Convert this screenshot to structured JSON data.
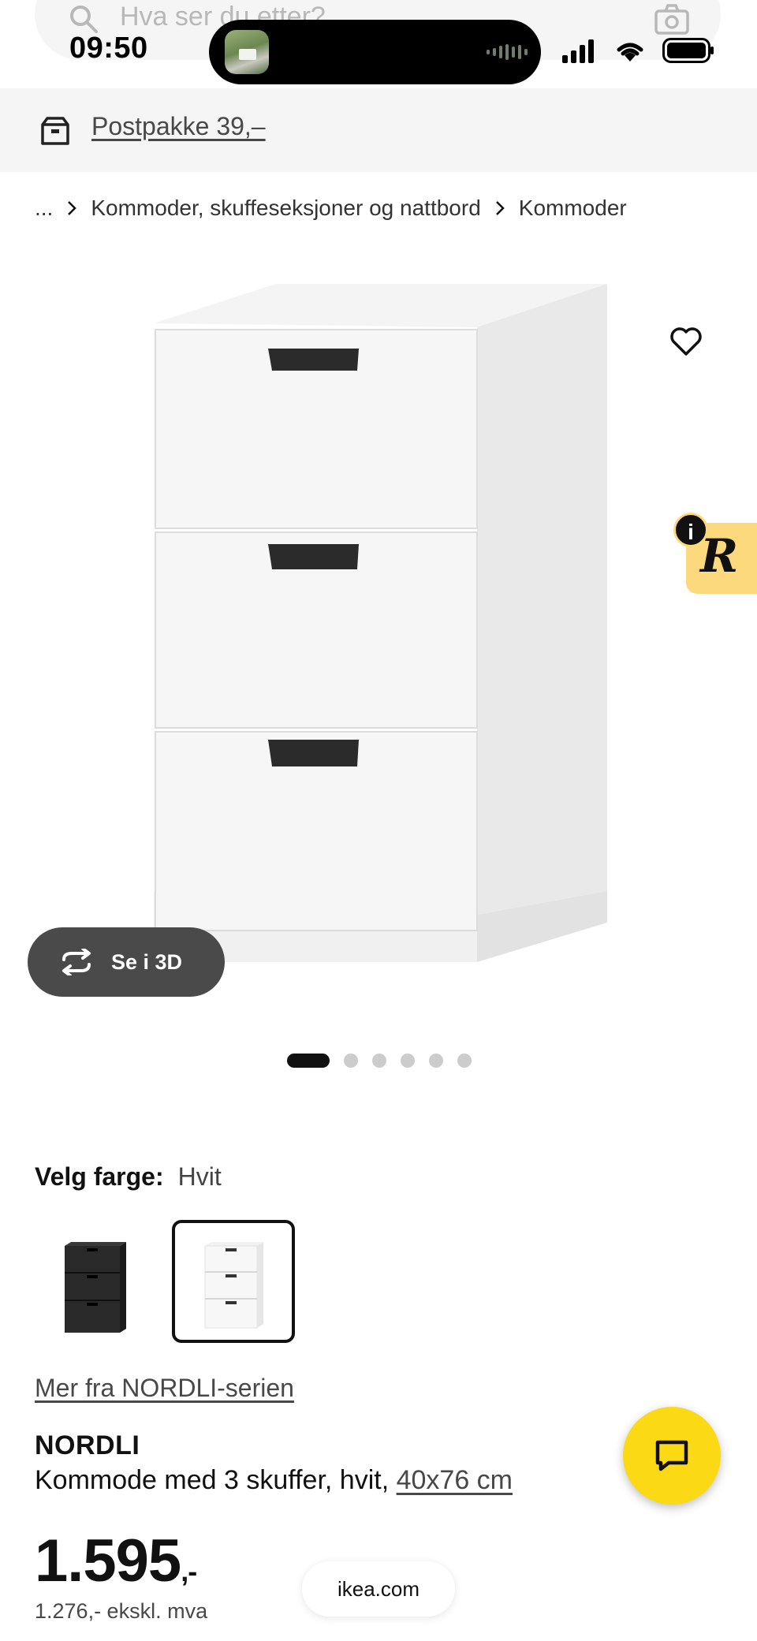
{
  "search": {
    "placeholder": "Hva ser du etter?"
  },
  "status_bar": {
    "time": "09:50"
  },
  "delivery": {
    "label": "Postpakke 39,–"
  },
  "breadcrumb": [
    "...",
    "Kommoder, skuffeseksjoner og nattbord",
    "Kommoder"
  ],
  "gallery": {
    "view3d_label": "Se i 3D",
    "image_count": 6,
    "active_index": 1
  },
  "color": {
    "label": "Velg farge:",
    "value": "Hvit",
    "options": [
      "black",
      "white"
    ],
    "selected": "white"
  },
  "series_link": "Mer fra NORDLI-serien",
  "product": {
    "name": "NORDLI",
    "description": "Kommode med 3 skuffer, hvit,",
    "size": "40x76 cm",
    "price": "1.595",
    "price_suffix": ",-",
    "price_ex_vat": "1.276,- ekskl. mva"
  },
  "browser": {
    "url": "ikea.com"
  },
  "badge": {
    "letter": "R",
    "info": "i"
  },
  "colors": {
    "chat_yellow": "#fbd914",
    "badge_yellow": "#fcd97c",
    "pill_dark": "#4a4a4a"
  },
  "icons": [
    "search-icon",
    "camera-icon",
    "box-icon",
    "heart-icon",
    "rotate-icon",
    "chat-icon"
  ]
}
